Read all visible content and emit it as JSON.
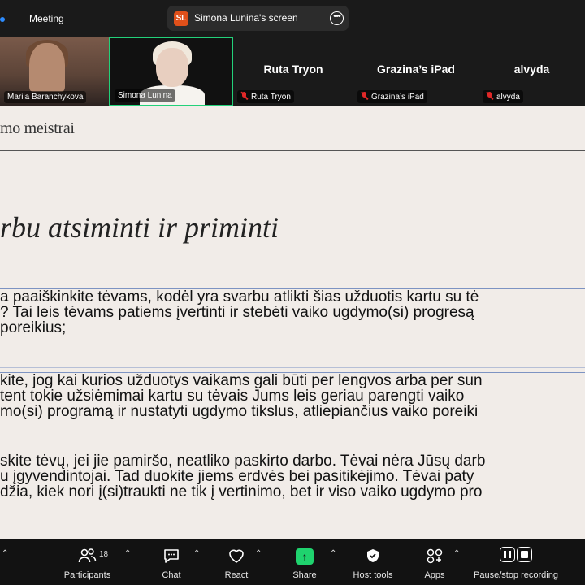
{
  "topbar": {
    "meeting_label": "Meeting",
    "share_pill": {
      "initials": "SL",
      "label": "Simona Lunina's screen",
      "more_glyph": "•••"
    }
  },
  "participants_strip": [
    {
      "name": "Mariia Baranchykova",
      "video": true,
      "muted": false
    },
    {
      "name": "Simona Lunina",
      "video": true,
      "muted": false,
      "active_speaker": true
    },
    {
      "name": "Ruta Tryon",
      "display_name": "Ruta Tryon",
      "video": false,
      "muted": true
    },
    {
      "name": "Grazina’s iPad",
      "display_name": "Grazina’s iPad",
      "video": false,
      "muted": true
    },
    {
      "name": "alvyda",
      "display_name": "alvyda",
      "video": false,
      "muted": true
    }
  ],
  "slide": {
    "brand": "mo meistrai",
    "title": "rbu atsiminti ir priminti",
    "blocks": [
      {
        "lines": [
          "a paaiškinkite tėvams, kodėl yra svarbu atlikti šias užduotis kartu su  tė",
          "? Tai leis tėvams patiems įvertinti ir stebėti vaiko ugdymo(si) progresą",
          "poreikius;"
        ]
      },
      {
        "lines": [
          "kite, jog kai kurios užduotys vaikams gali būti per lengvos arba per sun",
          "tent tokie užsiėmimai kartu su tėvais Jums leis geriau parengti vaiko",
          "mo(si) programą ir nustatyti ugdymo tikslus, atliepiančius vaiko poreiki"
        ]
      },
      {
        "lines": [
          "skite tėvų, jei jie pamiršo, neatliko paskirto darbo. Tėvai nėra Jūsų darb",
          "u įgyvendintojai. Tad duokite jiems erdvės bei pasitikėjimo. Tėvai paty",
          "džia, kiek nori į(si)traukti ne tik į vertinimo, bet ir viso vaiko ugdymo pro"
        ]
      }
    ]
  },
  "toolbar": {
    "participants": {
      "label": "Participants",
      "count": "18",
      "icon": "participants-icon"
    },
    "chat": {
      "label": "Chat",
      "icon": "chat-icon"
    },
    "react": {
      "label": "React",
      "icon": "heart-icon"
    },
    "share": {
      "label": "Share",
      "icon": "share-arrow-icon"
    },
    "host_tools": {
      "label": "Host tools",
      "icon": "shield-icon"
    },
    "apps": {
      "label": "Apps",
      "icon": "apps-icon"
    },
    "recording": {
      "label": "Pause/stop recording",
      "icon": "record-controls-icon"
    }
  },
  "colors": {
    "active_speaker_border": "#23d17a",
    "share_green": "#1fd36e",
    "muted_red": "#e02828",
    "slide_background": "#f1ece8",
    "block_rule": "#7d93c2"
  }
}
